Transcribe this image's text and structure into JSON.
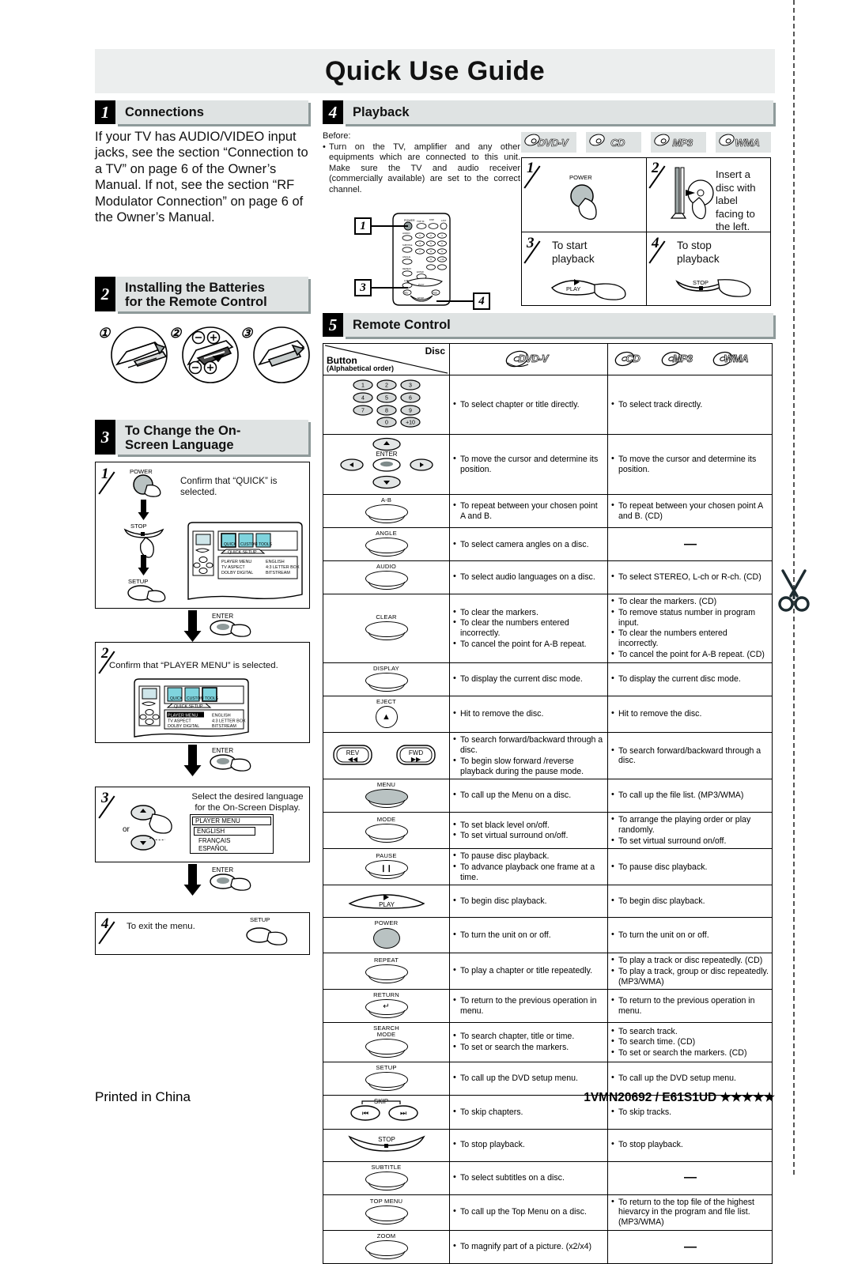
{
  "document": {
    "title": "Quick Use Guide",
    "footer_left": "Printed in China",
    "footer_right": "1VMN20692 / E61S1UD ★★★★★"
  },
  "sections": {
    "connections": {
      "number": "1",
      "label": "Connections",
      "body": "If your TV has AUDIO/VIDEO input jacks, see the section “Connection to a TV” on page 6 of the Owner’s Manual. If not, see the section “RF Modulator Connection” on page 6 of the Owner’s Manual."
    },
    "batteries": {
      "number": "2",
      "label_line1": "Installing the Batteries",
      "label_line2": "for the Remote Control",
      "steps": [
        "1",
        "2",
        "3"
      ],
      "polarity": [
        "–",
        "+"
      ]
    },
    "language": {
      "number": "3",
      "label_line1": "To Change the On-",
      "label_line2": "Screen Language",
      "step1": {
        "num": "1",
        "buttons": [
          "POWER",
          "STOP",
          "SETUP"
        ],
        "text": "Confirm that “QUICK” is selected.",
        "osd": {
          "tabs": [
            "QUICK",
            "CUSTOM",
            "TOOLS"
          ],
          "panel_title": "QUICK SETUP",
          "rows": [
            {
              "name": "PLAYER MENU",
              "value": "ENGLISH"
            },
            {
              "name": "TV ASPECT",
              "value": "4:3 LETTER BOX"
            },
            {
              "name": "DOLBY DIGITAL",
              "value": "BITSTREAM"
            }
          ]
        }
      },
      "enter_label": "ENTER",
      "step2": {
        "num": "2",
        "text": "Confirm that “PLAYER MENU” is selected.",
        "osd": {
          "tabs": [
            "QUICK",
            "CUSTOM",
            "TOOLS"
          ],
          "panel_title": "QUICK SETUP",
          "rows": [
            {
              "name": "PLAYER MENU",
              "value": "ENGLISH"
            },
            {
              "name": "TV ASPECT",
              "value": "4:3 LETTER BOX"
            },
            {
              "name": "DOLBY DIGITAL",
              "value": "BITSTREAM"
            }
          ]
        }
      },
      "step3": {
        "num": "3",
        "text": "Select the desired language for the On-Screen Display.",
        "or_label": "or",
        "menu_title": "PLAYER MENU",
        "languages": [
          "ENGLISH",
          "FRANÇAIS",
          "ESPAÑOL"
        ]
      },
      "step4": {
        "num": "4",
        "text": "To exit the menu.",
        "button": "SETUP"
      }
    },
    "playback": {
      "number": "4",
      "label": "Playback",
      "before_label": "Before:",
      "before_text": "Turn on the TV, amplifier and any other equipments which are connected to this unit. Make sure the TV and audio receiver (commercially available) are set to the correct channel.",
      "media_badges": [
        "DVD-V",
        "CD",
        "MP3",
        "WMA"
      ],
      "remote_callouts": [
        "1",
        "3",
        "4"
      ],
      "steps": [
        {
          "num": "1",
          "caption": "",
          "button": "POWER"
        },
        {
          "num": "2",
          "caption": "Insert a disc with label facing to the left."
        },
        {
          "num": "3",
          "caption": "To start playback",
          "button": "PLAY"
        },
        {
          "num": "4",
          "caption": "To stop playback",
          "button": "STOP"
        }
      ]
    },
    "remote": {
      "number": "5",
      "label": "Remote Control",
      "table": {
        "header": {
          "corner_disc": "Disc",
          "corner_button": "Button",
          "corner_button_sub": "(Alphabetical order)",
          "col_dvd": "DVD-V",
          "col_other": [
            "CD",
            "MP3",
            "WMA"
          ]
        },
        "rows": [
          {
            "button": "numbers",
            "keys": [
              "1",
              "2",
              "3",
              "4",
              "5",
              "6",
              "7",
              "8",
              "9",
              "0",
              "+10"
            ],
            "dvd": [
              "To select chapter or title directly."
            ],
            "other": [
              "To select track directly."
            ]
          },
          {
            "button": "cursor",
            "label": "ENTER",
            "dvd": [
              "To move the cursor and determine its position."
            ],
            "other": [
              "To move the cursor and determine its position."
            ]
          },
          {
            "button": "A-B",
            "dvd": [
              "To repeat between your chosen point A and B."
            ],
            "other": [
              "To repeat between your chosen point A and B. (CD)"
            ]
          },
          {
            "button": "ANGLE",
            "dvd": [
              "To select camera angles on a disc."
            ],
            "other": [
              "—"
            ]
          },
          {
            "button": "AUDIO",
            "dvd": [
              "To select audio languages on a disc."
            ],
            "other": [
              "To select STEREO, L-ch or R-ch. (CD)"
            ]
          },
          {
            "button": "CLEAR",
            "dvd": [
              "To clear the markers.",
              "To clear the numbers entered incorrectly.",
              "To cancel the point for A-B repeat."
            ],
            "other": [
              "To clear the markers. (CD)",
              "To remove status number in program input.",
              "To clear the numbers entered incorrectly.",
              "To cancel the point for A-B repeat. (CD)"
            ]
          },
          {
            "button": "DISPLAY",
            "dvd": [
              "To display the current disc mode."
            ],
            "other": [
              "To display the current disc mode."
            ]
          },
          {
            "button": "EJECT",
            "dvd": [
              "Hit to remove the disc."
            ],
            "other": [
              "Hit to remove the disc."
            ]
          },
          {
            "button": "REV/FWD",
            "keys": [
              "REV",
              "FWD"
            ],
            "dvd": [
              "To search forward/backward through a disc.",
              "To begin slow forward /reverse playback during the pause mode."
            ],
            "other": [
              "To search forward/backward through a disc."
            ]
          },
          {
            "button": "MENU",
            "dvd": [
              "To call up the Menu on a disc."
            ],
            "other": [
              "To call up the file list. (MP3/WMA)"
            ]
          },
          {
            "button": "MODE",
            "dvd": [
              "To set black level on/off.",
              "To set virtual surround on/off."
            ],
            "other": [
              "To arrange the playing order or play randomly.",
              "To set virtual surround on/off."
            ]
          },
          {
            "button": "PAUSE",
            "dvd": [
              "To pause disc playback.",
              "To advance playback one frame at a time."
            ],
            "other": [
              "To pause disc playback."
            ]
          },
          {
            "button": "PLAY",
            "dvd": [
              "To begin disc playback."
            ],
            "other": [
              "To begin disc playback."
            ]
          },
          {
            "button": "POWER",
            "dvd": [
              "To turn the unit on or off."
            ],
            "other": [
              "To turn the unit on or off."
            ]
          },
          {
            "button": "REPEAT",
            "dvd": [
              "To play a chapter or title repeatedly."
            ],
            "other": [
              "To play a track or disc repeatedly. (CD)",
              "To play a track, group or disc repeatedly. (MP3/WMA)"
            ]
          },
          {
            "button": "RETURN",
            "dvd": [
              "To return to the previous operation in menu."
            ],
            "other": [
              "To return to the previous operation in menu."
            ]
          },
          {
            "button": "SEARCH MODE",
            "dvd": [
              "To search chapter, title or time.",
              "To set or search the markers."
            ],
            "other": [
              "To search track.",
              "To search time. (CD)",
              "To set or search the markers. (CD)"
            ]
          },
          {
            "button": "SETUP",
            "dvd": [
              "To call up the DVD setup menu."
            ],
            "other": [
              "To call up the DVD setup menu."
            ]
          },
          {
            "button": "SKIP",
            "dvd": [
              "To skip chapters."
            ],
            "other": [
              "To skip tracks."
            ]
          },
          {
            "button": "STOP",
            "dvd": [
              "To stop playback."
            ],
            "other": [
              "To stop playback."
            ]
          },
          {
            "button": "SUBTITLE",
            "dvd": [
              "To select subtitles on a disc."
            ],
            "other": [
              "—"
            ]
          },
          {
            "button": "TOP MENU",
            "dvd": [
              "To call up the Top Menu on a disc."
            ],
            "other": [
              "To return to the top file of the highest hievarcy in the program and file list. (MP3/WMA)"
            ]
          },
          {
            "button": "ZOOM",
            "dvd": [
              "To magnify part of a picture. (x2/x4)"
            ],
            "other": [
              "—"
            ]
          }
        ]
      }
    }
  }
}
